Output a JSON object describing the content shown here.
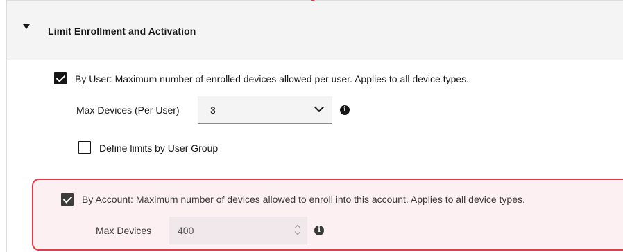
{
  "section": {
    "title": "Limit Enrollment and Activation"
  },
  "by_user": {
    "label": "By User: Maximum number of enrolled devices allowed per user. Applies to all device types.",
    "checked": true,
    "max_devices_label": "Max Devices (Per User)",
    "max_devices_value": "3",
    "info_icon": "info-icon",
    "user_group": {
      "label": "Define limits by User Group",
      "checked": false
    }
  },
  "by_account": {
    "label": "By Account: Maximum number of devices allowed to enroll into this account. Applies to all device types.",
    "checked": true,
    "max_devices_label": "Max Devices",
    "max_devices_value": "400",
    "info_icon": "info-icon"
  },
  "colors": {
    "highlight_border": "#e8394c",
    "highlight_background": "#fdf0f2",
    "pointer": "#e0394a"
  }
}
